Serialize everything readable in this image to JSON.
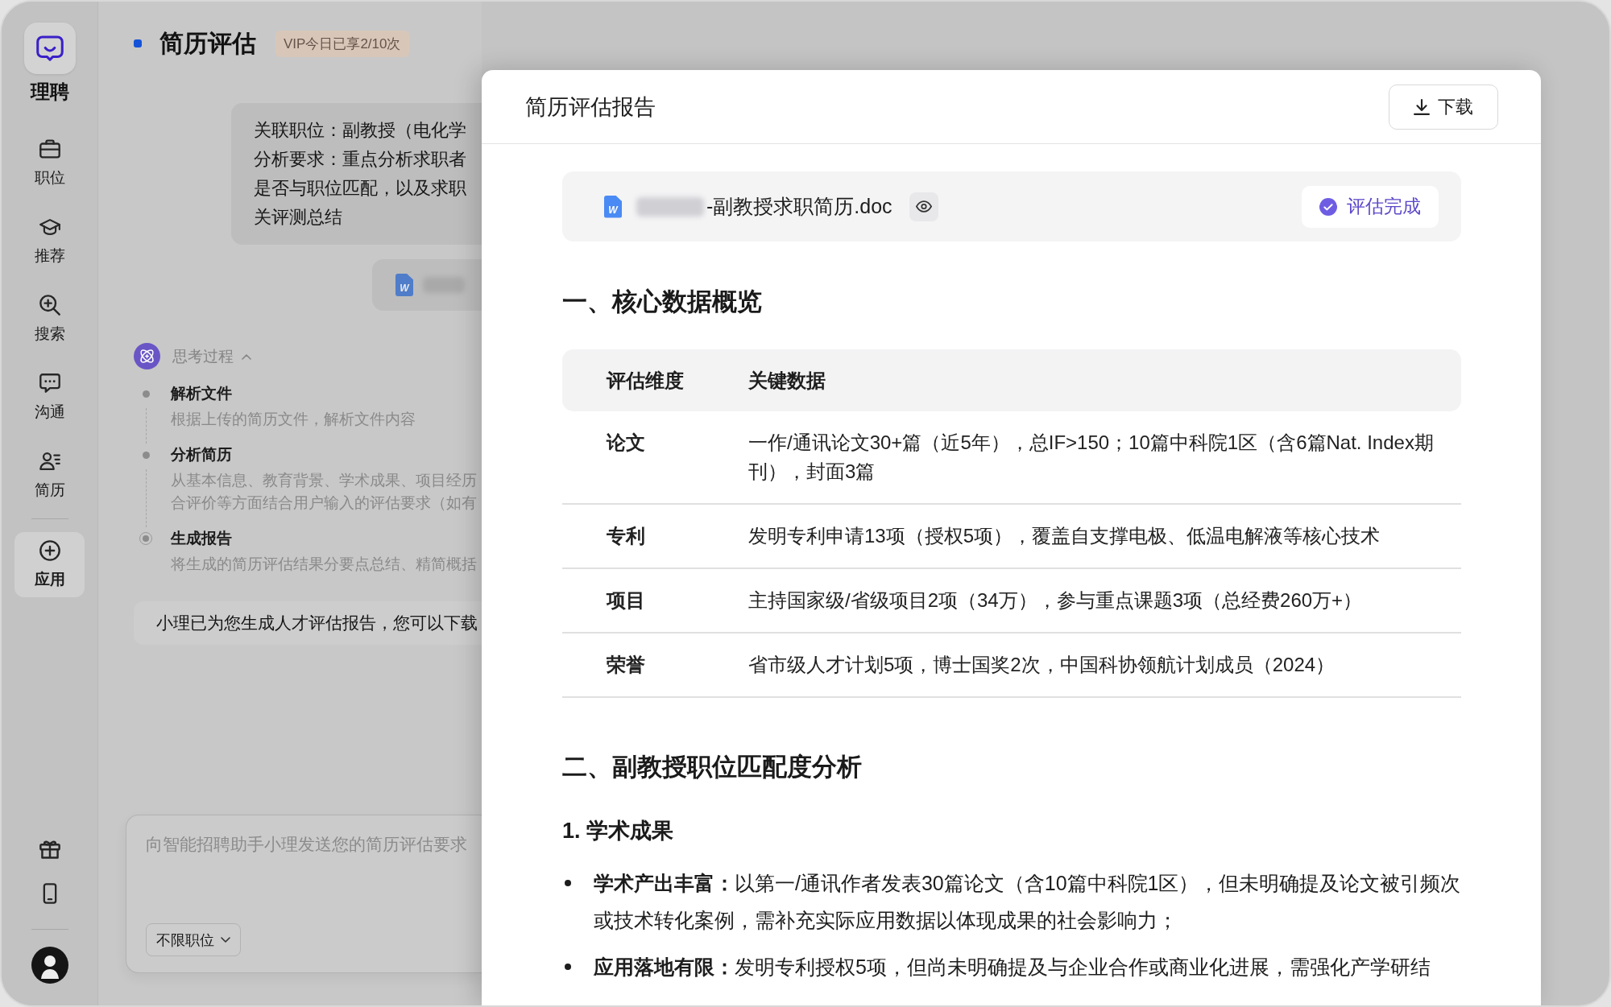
{
  "sidebar": {
    "brand": "理聘",
    "nav_groups": [
      {
        "items": [
          {
            "label": "职位",
            "selected": false
          },
          {
            "label": "推荐",
            "selected": false
          },
          {
            "label": "搜索",
            "selected": false
          },
          {
            "label": "沟通",
            "selected": false
          },
          {
            "label": "简历",
            "selected": false
          }
        ]
      },
      {
        "items": [
          {
            "label": "应用",
            "selected": true
          }
        ]
      }
    ]
  },
  "chat": {
    "title": "简历评估",
    "quota_badge": "VIP今日已享2/10次",
    "request": {
      "lines": [
        "关联职位：副教授（电化学",
        "分析要求：重点分析求职者",
        "是否与职位匹配，以及求职",
        "关评测总结"
      ]
    },
    "attachment": {
      "icon_letter": "W"
    },
    "thinking": {
      "label": "思考过程",
      "expanded": true,
      "steps": [
        {
          "title": "解析文件",
          "description_lines": [
            "根据上传的简历文件，解析文件内容"
          ],
          "current": false
        },
        {
          "title": "分析简历",
          "description_lines": [
            "从基本信息、教育背景、学术成果、项目经历",
            "合评价等方面结合用户输入的评估要求（如有"
          ],
          "current": false
        },
        {
          "title": "生成报告",
          "description_lines": [
            "将生成的简历评估结果分要点总结、精简概括"
          ],
          "current": true
        }
      ]
    },
    "reply": "小理已为您生成人才评估报告，您可以下载",
    "composer": {
      "placeholder": "向智能招聘助手小理发送您的简历评估要求",
      "position_filter": "不限职位"
    }
  },
  "report": {
    "title": "简历评估报告",
    "download_button": "下载",
    "file": {
      "icon_letter": "W",
      "name": "-副教授求职简历.doc",
      "status": "评估完成"
    },
    "sections": [
      {
        "heading": "一、核心数据概览",
        "table": {
          "columns": [
            "评估维度",
            "关键数据"
          ],
          "rows": [
            [
              "论文",
              "一作/通讯论文30+篇（近5年），总IF>150；10篇中科院1区（含6篇Nat. Index期刊），封面3篇"
            ],
            [
              "专利",
              "发明专利申请13项（授权5项），覆盖自支撑电极、低温电解液等核心技术"
            ],
            [
              "项目",
              "主持国家级/省级项目2项（34万），参与重点课题3项（总经费260万+）"
            ],
            [
              "荣誉",
              "省市级人才计划5项，博士国奖2次，中国科协领航计划成员（2024）"
            ]
          ]
        }
      },
      {
        "heading": "二、副教授职位匹配度分析",
        "subsections": [
          {
            "heading": "1. 学术成果",
            "bullets": [
              "**学术产出丰富：**以第一/通讯作者发表30篇论文（含10篇中科院1区），但未明确提及论文被引频次或技术转化案例，需补充实际应用数据以体现成果的社会影响力；",
              "**应用落地有限：**发明专利授权5项，但尚未明确提及与企业合作或商业化进展，需强化产学研结"
            ]
          }
        ]
      }
    ]
  }
}
